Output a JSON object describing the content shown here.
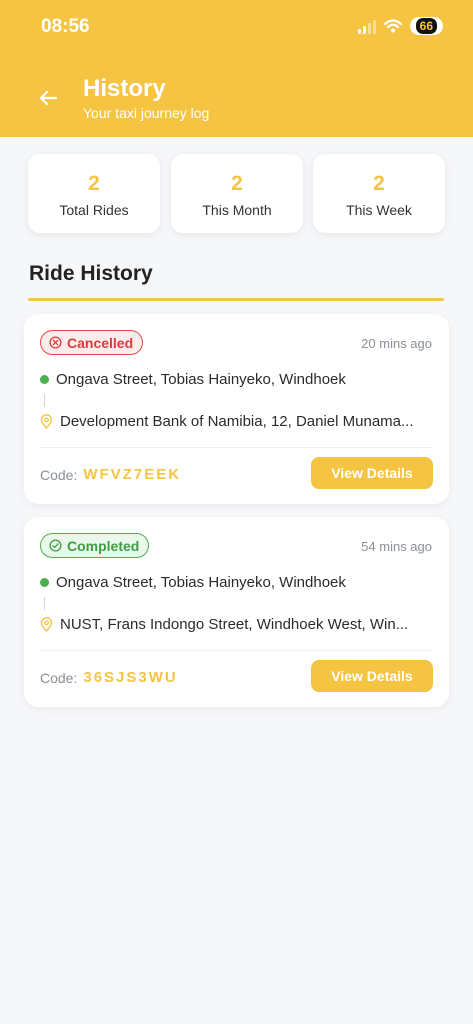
{
  "status_bar": {
    "time": "08:56",
    "battery": "66"
  },
  "header": {
    "title": "History",
    "subtitle": "Your taxi journey log"
  },
  "stats": [
    {
      "value": "2",
      "label": "Total Rides"
    },
    {
      "value": "2",
      "label": "This Month"
    },
    {
      "value": "2",
      "label": "This Week"
    }
  ],
  "section_title": "Ride History",
  "rides": [
    {
      "status": "Cancelled",
      "time_ago": "20 mins ago",
      "pickup": "Ongava Street, Tobias Hainyeko, Windhoek",
      "dropoff": "Development Bank of Namibia, 12, Daniel Munama...",
      "code_label": "Code:",
      "code": "WFVZ7EEK",
      "button": "View Details"
    },
    {
      "status": "Completed",
      "time_ago": "54 mins ago",
      "pickup": "Ongava Street, Tobias Hainyeko, Windhoek",
      "dropoff": "NUST, Frans Indongo Street, Windhoek West, Win...",
      "code_label": "Code:",
      "code": "36SJS3WU",
      "button": "View Details"
    }
  ],
  "colors": {
    "accent": "#f5c443",
    "cancelled": "#e03b3b",
    "completed": "#4caf50"
  },
  "icons": [
    "back-arrow-icon",
    "cancelled-x-icon",
    "completed-check-icon",
    "pin-icon",
    "wifi-icon",
    "signal-icon"
  ]
}
